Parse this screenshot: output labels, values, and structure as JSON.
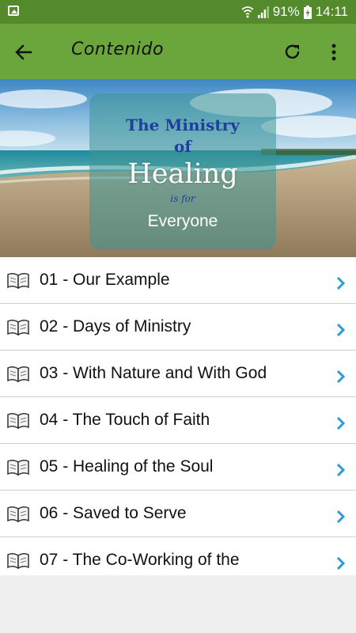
{
  "status_bar": {
    "battery_percent": "91%",
    "time": "14:11",
    "icons": [
      "gallery-icon",
      "wifi-icon",
      "signal-icon",
      "battery-charging-icon"
    ]
  },
  "app_bar": {
    "title": "Contenido",
    "icons": [
      "back-arrow-icon",
      "refresh-icon",
      "more-vert-icon"
    ]
  },
  "banner": {
    "line1": "The Ministry",
    "line2": "of",
    "line3": "Healing",
    "line4": "is for",
    "line5": "Everyone"
  },
  "chapters": [
    {
      "label": "01 - Our Example"
    },
    {
      "label": "02 - Days of Ministry"
    },
    {
      "label": "03 - With Nature and With God"
    },
    {
      "label": "04 - The Touch of Faith"
    },
    {
      "label": "05 - Healing of the Soul"
    },
    {
      "label": "06 - Saved to Serve"
    },
    {
      "label": "07 - The Co-Working of the"
    }
  ],
  "colors": {
    "status_bar": "#528a2c",
    "app_bar": "#6aa63b",
    "chevron": "#2e9ad6",
    "divider": "#cfcfcf",
    "background": "#efefef"
  }
}
